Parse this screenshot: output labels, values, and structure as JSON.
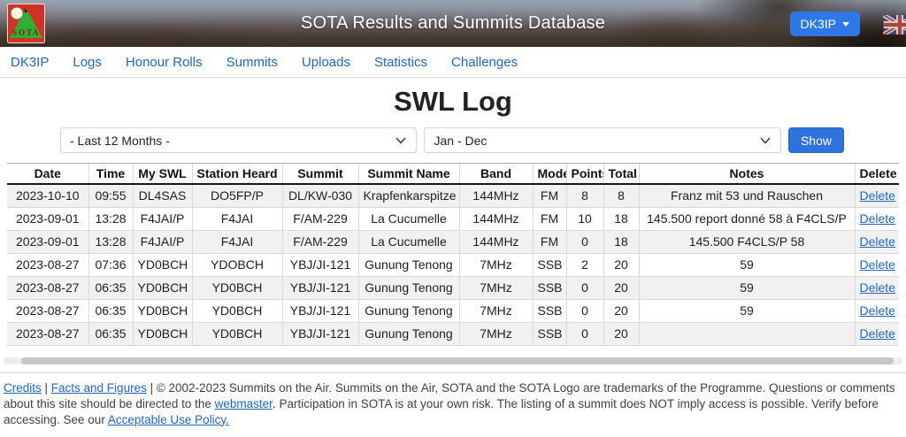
{
  "colors": {
    "accent_blue": "#2e77e5",
    "link_blue": "#2267c2",
    "row_stripe": "#f1f1f2",
    "logo_red": "#cf3226",
    "logo_green": "#33ad35"
  },
  "header": {
    "title": "SOTA Results and Summits Database",
    "logo_text": "SOTA",
    "user_button_label": "DK3IP",
    "language_flag": "uk-flag"
  },
  "nav": {
    "items": [
      {
        "label": "DK3IP"
      },
      {
        "label": "Logs"
      },
      {
        "label": "Honour Rolls"
      },
      {
        "label": "Summits"
      },
      {
        "label": "Uploads"
      },
      {
        "label": "Statistics"
      },
      {
        "label": "Challenges"
      }
    ]
  },
  "page": {
    "title": "SWL Log"
  },
  "filters": {
    "period_selected": "- Last 12 Months -",
    "months_selected": "Jan - Dec",
    "show_label": "Show"
  },
  "table": {
    "headers": [
      "Date",
      "Time",
      "My SWL",
      "Station Heard",
      "Summit",
      "Summit Name",
      "Band",
      "Mode",
      "Points",
      "Total",
      "Notes",
      "Delete"
    ],
    "rows": [
      {
        "date": "2023-10-10",
        "time": "09:55",
        "my_swl": "DL4SAS",
        "station_heard": "DO5FP/P",
        "summit": "DL/KW-030",
        "summit_name": "Krapfenkarspitze",
        "band": "144MHz",
        "mode": "FM",
        "points": "8",
        "total": "8",
        "notes": "Franz mit 53 und Rauschen",
        "delete": "Delete"
      },
      {
        "date": "2023-09-01",
        "time": "13:28",
        "my_swl": "F4JAI/P",
        "station_heard": "F4JAI",
        "summit": "F/AM-229",
        "summit_name": "La Cucumelle",
        "band": "144MHz",
        "mode": "FM",
        "points": "10",
        "total": "18",
        "notes": "145.500 report donné 58 à F4CLS/P",
        "delete": "Delete"
      },
      {
        "date": "2023-09-01",
        "time": "13:28",
        "my_swl": "F4JAI/P",
        "station_heard": "F4JAI",
        "summit": "F/AM-229",
        "summit_name": "La Cucumelle",
        "band": "144MHz",
        "mode": "FM",
        "points": "0",
        "total": "18",
        "notes": "145.500 F4CLS/P 58",
        "delete": "Delete"
      },
      {
        "date": "2023-08-27",
        "time": "07:36",
        "my_swl": "YD0BCH",
        "station_heard": "YDOBCH",
        "summit": "YBJ/JI-121",
        "summit_name": "Gunung Tenong",
        "band": "7MHz",
        "mode": "SSB",
        "points": "2",
        "total": "20",
        "notes": "59",
        "delete": "Delete"
      },
      {
        "date": "2023-08-27",
        "time": "06:35",
        "my_swl": "YD0BCH",
        "station_heard": "YD0BCH",
        "summit": "YBJ/JI-121",
        "summit_name": "Gunung Tenong",
        "band": "7MHz",
        "mode": "SSB",
        "points": "0",
        "total": "20",
        "notes": "59",
        "delete": "Delete"
      },
      {
        "date": "2023-08-27",
        "time": "06:35",
        "my_swl": "YD0BCH",
        "station_heard": "YD0BCH",
        "summit": "YBJ/JI-121",
        "summit_name": "Gunung Tenong",
        "band": "7MHz",
        "mode": "SSB",
        "points": "0",
        "total": "20",
        "notes": "59",
        "delete": "Delete"
      },
      {
        "date": "2023-08-27",
        "time": "06:35",
        "my_swl": "YD0BCH",
        "station_heard": "YD0BCH",
        "summit": "YBJ/JI-121",
        "summit_name": "Gunung Tenong",
        "band": "7MHz",
        "mode": "SSB",
        "points": "0",
        "total": "20",
        "notes": "",
        "delete": "Delete"
      }
    ]
  },
  "footer": {
    "credits_link": "Credits",
    "separator": " | ",
    "facts_link": "Facts and Figures",
    "text1": " | © 2002-2023 Summits on the Air. Summits on the Air, SOTA and the SOTA Logo are trademarks of the Programme. Questions or comments about this site should be directed to the ",
    "webmaster_link": "webmaster",
    "text2": ". Participation in SOTA is at your own risk. The listing of a summit does NOT imply access is possible. Verify before accessing. See our ",
    "aup_link": "Acceptable Use Policy."
  }
}
